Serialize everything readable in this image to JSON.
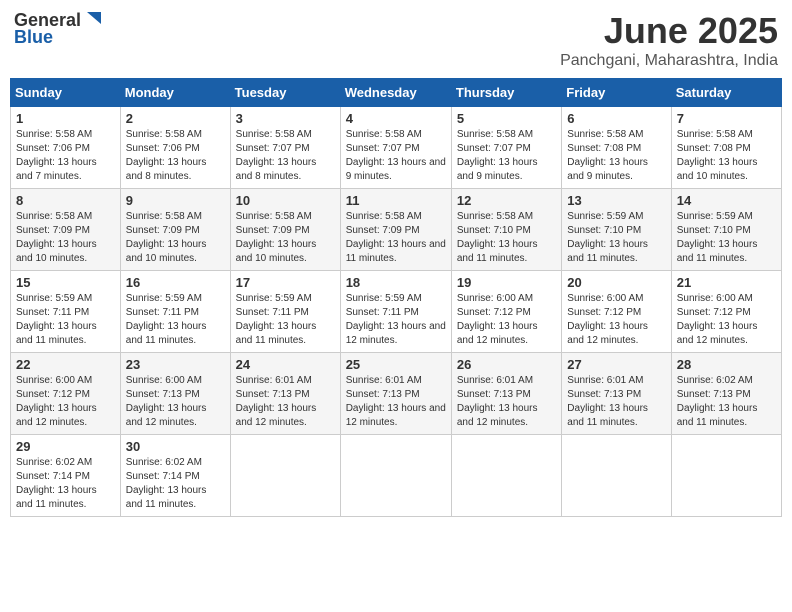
{
  "header": {
    "logo_general": "General",
    "logo_blue": "Blue",
    "month": "June 2025",
    "location": "Panchgani, Maharashtra, India"
  },
  "days_of_week": [
    "Sunday",
    "Monday",
    "Tuesday",
    "Wednesday",
    "Thursday",
    "Friday",
    "Saturday"
  ],
  "weeks": [
    [
      {
        "day": "1",
        "sunrise": "5:58 AM",
        "sunset": "7:06 PM",
        "daylight": "13 hours and 7 minutes."
      },
      {
        "day": "2",
        "sunrise": "5:58 AM",
        "sunset": "7:06 PM",
        "daylight": "13 hours and 8 minutes."
      },
      {
        "day": "3",
        "sunrise": "5:58 AM",
        "sunset": "7:07 PM",
        "daylight": "13 hours and 8 minutes."
      },
      {
        "day": "4",
        "sunrise": "5:58 AM",
        "sunset": "7:07 PM",
        "daylight": "13 hours and 9 minutes."
      },
      {
        "day": "5",
        "sunrise": "5:58 AM",
        "sunset": "7:07 PM",
        "daylight": "13 hours and 9 minutes."
      },
      {
        "day": "6",
        "sunrise": "5:58 AM",
        "sunset": "7:08 PM",
        "daylight": "13 hours and 9 minutes."
      },
      {
        "day": "7",
        "sunrise": "5:58 AM",
        "sunset": "7:08 PM",
        "daylight": "13 hours and 10 minutes."
      }
    ],
    [
      {
        "day": "8",
        "sunrise": "5:58 AM",
        "sunset": "7:09 PM",
        "daylight": "13 hours and 10 minutes."
      },
      {
        "day": "9",
        "sunrise": "5:58 AM",
        "sunset": "7:09 PM",
        "daylight": "13 hours and 10 minutes."
      },
      {
        "day": "10",
        "sunrise": "5:58 AM",
        "sunset": "7:09 PM",
        "daylight": "13 hours and 10 minutes."
      },
      {
        "day": "11",
        "sunrise": "5:58 AM",
        "sunset": "7:09 PM",
        "daylight": "13 hours and 11 minutes."
      },
      {
        "day": "12",
        "sunrise": "5:58 AM",
        "sunset": "7:10 PM",
        "daylight": "13 hours and 11 minutes."
      },
      {
        "day": "13",
        "sunrise": "5:59 AM",
        "sunset": "7:10 PM",
        "daylight": "13 hours and 11 minutes."
      },
      {
        "day": "14",
        "sunrise": "5:59 AM",
        "sunset": "7:10 PM",
        "daylight": "13 hours and 11 minutes."
      }
    ],
    [
      {
        "day": "15",
        "sunrise": "5:59 AM",
        "sunset": "7:11 PM",
        "daylight": "13 hours and 11 minutes."
      },
      {
        "day": "16",
        "sunrise": "5:59 AM",
        "sunset": "7:11 PM",
        "daylight": "13 hours and 11 minutes."
      },
      {
        "day": "17",
        "sunrise": "5:59 AM",
        "sunset": "7:11 PM",
        "daylight": "13 hours and 11 minutes."
      },
      {
        "day": "18",
        "sunrise": "5:59 AM",
        "sunset": "7:11 PM",
        "daylight": "13 hours and 12 minutes."
      },
      {
        "day": "19",
        "sunrise": "6:00 AM",
        "sunset": "7:12 PM",
        "daylight": "13 hours and 12 minutes."
      },
      {
        "day": "20",
        "sunrise": "6:00 AM",
        "sunset": "7:12 PM",
        "daylight": "13 hours and 12 minutes."
      },
      {
        "day": "21",
        "sunrise": "6:00 AM",
        "sunset": "7:12 PM",
        "daylight": "13 hours and 12 minutes."
      }
    ],
    [
      {
        "day": "22",
        "sunrise": "6:00 AM",
        "sunset": "7:12 PM",
        "daylight": "13 hours and 12 minutes."
      },
      {
        "day": "23",
        "sunrise": "6:00 AM",
        "sunset": "7:13 PM",
        "daylight": "13 hours and 12 minutes."
      },
      {
        "day": "24",
        "sunrise": "6:01 AM",
        "sunset": "7:13 PM",
        "daylight": "13 hours and 12 minutes."
      },
      {
        "day": "25",
        "sunrise": "6:01 AM",
        "sunset": "7:13 PM",
        "daylight": "13 hours and 12 minutes."
      },
      {
        "day": "26",
        "sunrise": "6:01 AM",
        "sunset": "7:13 PM",
        "daylight": "13 hours and 12 minutes."
      },
      {
        "day": "27",
        "sunrise": "6:01 AM",
        "sunset": "7:13 PM",
        "daylight": "13 hours and 11 minutes."
      },
      {
        "day": "28",
        "sunrise": "6:02 AM",
        "sunset": "7:13 PM",
        "daylight": "13 hours and 11 minutes."
      }
    ],
    [
      {
        "day": "29",
        "sunrise": "6:02 AM",
        "sunset": "7:14 PM",
        "daylight": "13 hours and 11 minutes."
      },
      {
        "day": "30",
        "sunrise": "6:02 AM",
        "sunset": "7:14 PM",
        "daylight": "13 hours and 11 minutes."
      },
      null,
      null,
      null,
      null,
      null
    ]
  ]
}
